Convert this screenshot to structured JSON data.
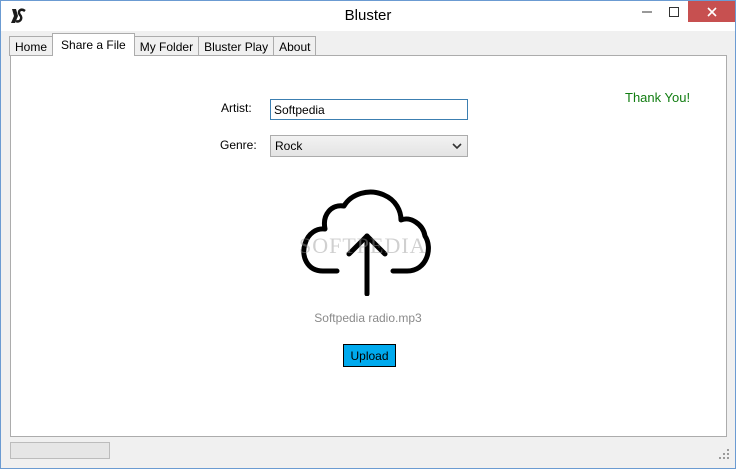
{
  "window": {
    "title": "Bluster",
    "icon": "app-logo-icon",
    "controls": {
      "minimize": "minimize-icon",
      "maximize": "maximize-icon",
      "close": "close-icon"
    }
  },
  "tabs": [
    {
      "label": "Home"
    },
    {
      "label": "Share a File",
      "active": true
    },
    {
      "label": "My Folder"
    },
    {
      "label": "Bluster Play"
    },
    {
      "label": "About"
    }
  ],
  "share": {
    "thank_you": "Thank You!",
    "artist_label": "Artist:",
    "artist_value": "Softpedia",
    "genre_label": "Genre:",
    "genre_value": "Rock",
    "upload_icon": "cloud-upload-icon",
    "watermark": "SOFTPEDIA",
    "file_name": "Softpedia radio.mp3",
    "upload_label": "Upload"
  },
  "colors": {
    "thank_you": "#117d11",
    "upload_button": "#00aaee",
    "close_button": "#c75050",
    "window_border": "#6b9bd2"
  },
  "statusbar": {
    "progress": 0
  }
}
